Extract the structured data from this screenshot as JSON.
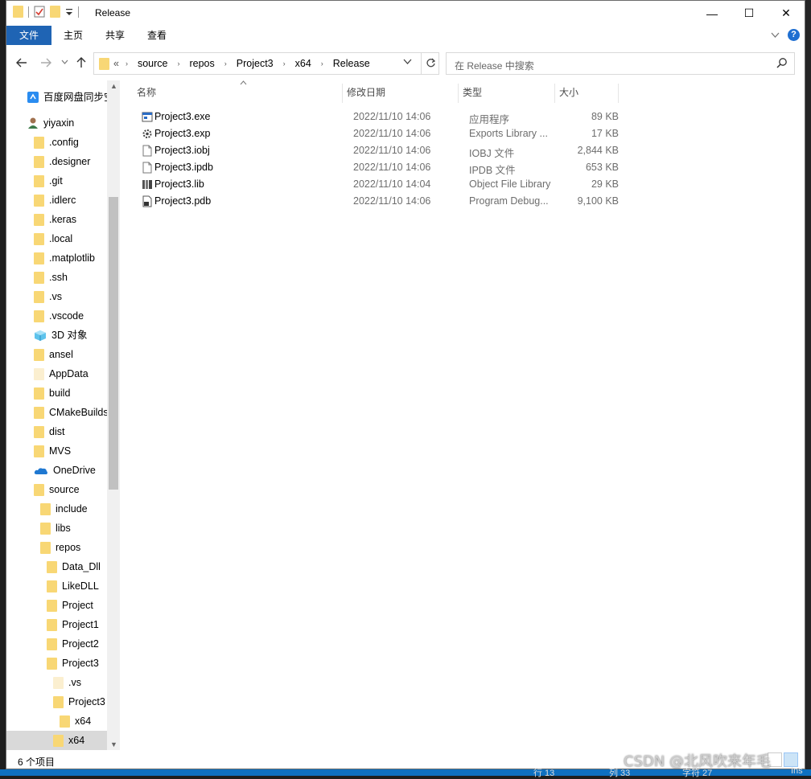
{
  "window": {
    "title": "Release",
    "controls": {
      "minimize": "—",
      "maximize": "☐",
      "close": "✕"
    }
  },
  "ribbon": {
    "tabs": [
      "文件",
      "主页",
      "共享",
      "查看"
    ],
    "help": "?"
  },
  "address": {
    "overflow": "«",
    "crumbs": [
      "source",
      "repos",
      "Project3",
      "x64",
      "Release"
    ]
  },
  "search": {
    "placeholder": "在 Release 中搜索"
  },
  "nav": {
    "items": [
      {
        "label": "百度网盘同步空",
        "icon": "baidu-sync-icon"
      },
      {
        "label": "yiyaxin",
        "icon": "user-icon"
      },
      {
        "label": ".config",
        "icon": "folder-icon"
      },
      {
        "label": ".designer",
        "icon": "folder-icon"
      },
      {
        "label": ".git",
        "icon": "folder-icon"
      },
      {
        "label": ".idlerc",
        "icon": "folder-icon"
      },
      {
        "label": ".keras",
        "icon": "folder-icon"
      },
      {
        "label": ".local",
        "icon": "folder-icon"
      },
      {
        "label": ".matplotlib",
        "icon": "folder-icon"
      },
      {
        "label": ".ssh",
        "icon": "folder-icon"
      },
      {
        "label": ".vs",
        "icon": "folder-icon"
      },
      {
        "label": ".vscode",
        "icon": "folder-icon"
      },
      {
        "label": "3D 对象",
        "icon": "3d-objects-icon"
      },
      {
        "label": "ansel",
        "icon": "folder-icon"
      },
      {
        "label": "AppData",
        "icon": "folder-pale-icon"
      },
      {
        "label": "build",
        "icon": "folder-icon"
      },
      {
        "label": "CMakeBuilds",
        "icon": "folder-icon"
      },
      {
        "label": "dist",
        "icon": "folder-icon"
      },
      {
        "label": "MVS",
        "icon": "folder-icon"
      },
      {
        "label": "OneDrive",
        "icon": "onedrive-icon"
      },
      {
        "label": "source",
        "icon": "folder-icon"
      },
      {
        "label": "include",
        "icon": "folder-icon"
      },
      {
        "label": "libs",
        "icon": "folder-icon"
      },
      {
        "label": "repos",
        "icon": "folder-icon"
      },
      {
        "label": "Data_Dll",
        "icon": "folder-icon"
      },
      {
        "label": "LikeDLL",
        "icon": "folder-icon"
      },
      {
        "label": "Project",
        "icon": "folder-icon"
      },
      {
        "label": "Project1",
        "icon": "folder-icon"
      },
      {
        "label": "Project2",
        "icon": "folder-icon"
      },
      {
        "label": "Project3",
        "icon": "folder-icon"
      },
      {
        "label": ".vs",
        "icon": "folder-pale-icon"
      },
      {
        "label": "Project3",
        "icon": "folder-icon"
      },
      {
        "label": "x64",
        "icon": "folder-icon"
      },
      {
        "label": "x64",
        "icon": "folder-icon",
        "selected": true
      }
    ]
  },
  "columns": {
    "name": "名称",
    "date": "修改日期",
    "type": "类型",
    "size": "大小"
  },
  "files": [
    {
      "name": "Project3.exe",
      "date": "2022/11/10 14:06",
      "type": "应用程序",
      "size": "89 KB",
      "icon": "exe-icon"
    },
    {
      "name": "Project3.exp",
      "date": "2022/11/10 14:06",
      "type": "Exports Library ...",
      "size": "17 KB",
      "icon": "gear-file-icon"
    },
    {
      "name": "Project3.iobj",
      "date": "2022/11/10 14:06",
      "type": "IOBJ 文件",
      "size": "2,844 KB",
      "icon": "blank-file-icon"
    },
    {
      "name": "Project3.ipdb",
      "date": "2022/11/10 14:06",
      "type": "IPDB 文件",
      "size": "653 KB",
      "icon": "blank-file-icon"
    },
    {
      "name": "Project3.lib",
      "date": "2022/11/10 14:04",
      "type": "Object File Library",
      "size": "29 KB",
      "icon": "library-icon"
    },
    {
      "name": "Project3.pdb",
      "date": "2022/11/10 14:06",
      "type": "Program Debug...",
      "size": "9,100 KB",
      "icon": "pdb-file-icon"
    }
  ],
  "status": {
    "count": "6 个项目"
  },
  "background": {
    "strip": [
      "行 13",
      "列 33",
      "字符 27",
      "Ins"
    ],
    "watermark": "CSDN @北风吹来年毛"
  }
}
